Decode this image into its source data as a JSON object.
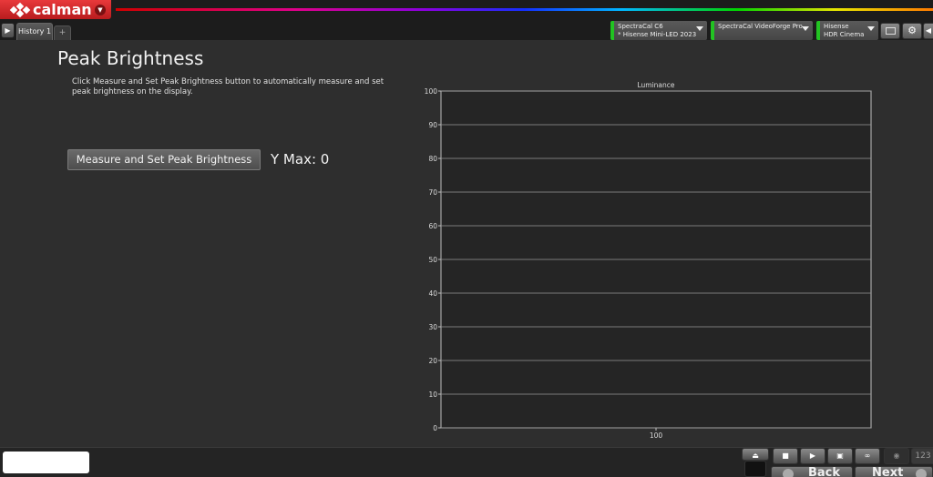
{
  "app": {
    "logo_text": "calman"
  },
  "tabs": [
    {
      "label": "History 1"
    }
  ],
  "devices": [
    {
      "line1": "SpectraCal C6",
      "line2": "* Hisense Mini-LED 2023"
    },
    {
      "line1": "SpectraCal VideoForge Pro",
      "line2": ""
    },
    {
      "line1": "Hisense",
      "line2": "HDR Cinema"
    }
  ],
  "main": {
    "title": "Peak Brightness",
    "description": "Click Measure and Set Peak Brightness button to automatically measure and set peak brightness on the display.",
    "measure_button": "Measure and Set Peak Brightness",
    "ymax_label": "Y Max:",
    "ymax_value": "0"
  },
  "chart_data": {
    "type": "bar",
    "title": "Luminance",
    "categories": [
      "100"
    ],
    "values": [
      0
    ],
    "ylim": [
      0,
      100
    ],
    "yticks": [
      0,
      10,
      20,
      30,
      40,
      50,
      60,
      70,
      80,
      90,
      100
    ],
    "grid": true
  },
  "footer": {
    "counter": "123",
    "back_label": "Back",
    "next_label": "Next"
  },
  "colors": {
    "brand_red": "#d42a2c",
    "device_active": "#22c322",
    "background": "#2e2e2e"
  }
}
